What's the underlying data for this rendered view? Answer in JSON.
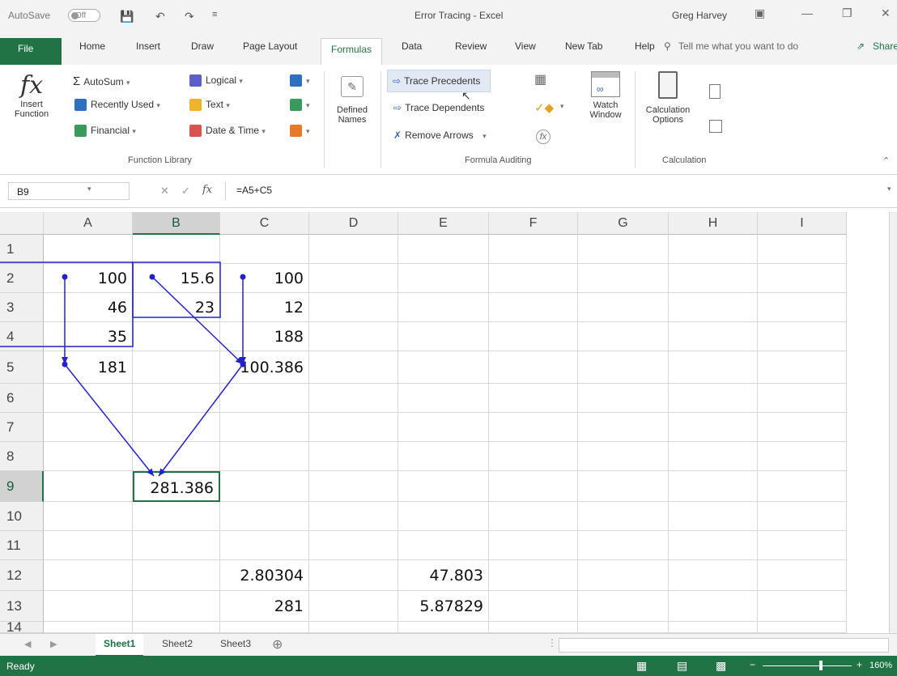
{
  "titlebar": {
    "autosave_label": "AutoSave",
    "autosave_state": "Off",
    "title": "Error Tracing - Excel",
    "user": "Greg Harvey"
  },
  "tabs": [
    "File",
    "Home",
    "Insert",
    "Draw",
    "Page Layout",
    "Formulas",
    "Data",
    "Review",
    "View",
    "New Tab",
    "Help"
  ],
  "active_tab": "Formulas",
  "tell_me": "Tell me what you want to do",
  "share": "Share",
  "ribbon": {
    "insert_function": [
      "Insert",
      "Function"
    ],
    "autosum": "AutoSum",
    "recently_used": "Recently Used",
    "financial": "Financial",
    "logical": "Logical",
    "text": "Text",
    "date_time": "Date & Time",
    "function_library_label": "Function Library",
    "defined_names": [
      "Defined",
      "Names"
    ],
    "trace_precedents": "Trace Precedents",
    "trace_dependents": "Trace Dependents",
    "remove_arrows": "Remove Arrows",
    "formula_auditing_label": "Formula Auditing",
    "watch_window": [
      "Watch",
      "Window"
    ],
    "calculation_options": [
      "Calculation",
      "Options"
    ],
    "calculation_label": "Calculation"
  },
  "formula_bar": {
    "name_box": "B9",
    "formula": "=A5+C5"
  },
  "columns": [
    "A",
    "B",
    "C",
    "D",
    "E",
    "F",
    "G",
    "H",
    "I"
  ],
  "selected_column": "B",
  "rows": [
    "1",
    "2",
    "3",
    "4",
    "5",
    "6",
    "7",
    "8",
    "9",
    "10",
    "11",
    "12",
    "13",
    "14"
  ],
  "selected_row": "9",
  "cells": {
    "A2": "100",
    "B2": "15.6",
    "C2": "100",
    "A3": "46",
    "B3": "23",
    "C3": "12",
    "A4": "35",
    "C4": "188",
    "A5": "181",
    "C5": "100.386",
    "B9": "281.386",
    "C12": "2.80304",
    "E12": "47.803",
    "C13": "281",
    "E13": "5.87829"
  },
  "sheets": [
    "Sheet1",
    "Sheet2",
    "Sheet3"
  ],
  "active_sheet": "Sheet1",
  "status": {
    "ready": "Ready",
    "zoom": "160%"
  },
  "colors": {
    "accent": "#217346",
    "trace_arrow": "#2222cc"
  }
}
